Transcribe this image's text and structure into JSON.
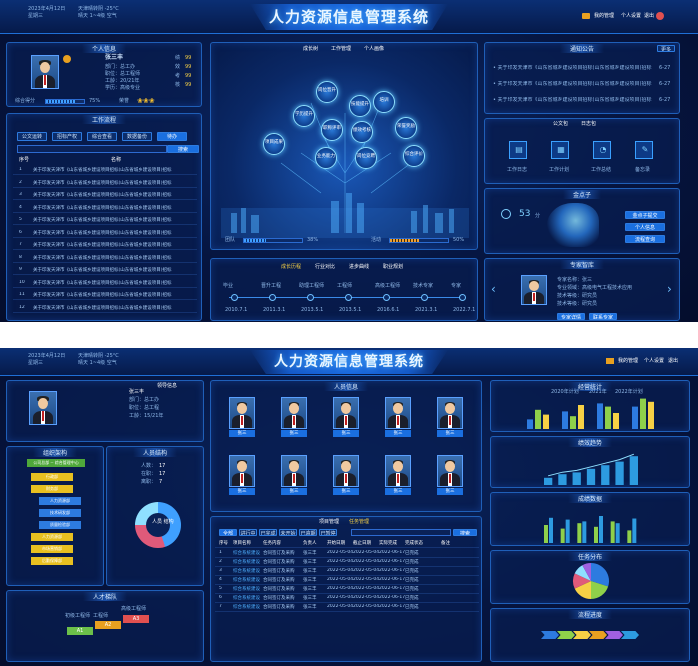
{
  "header": {
    "title": "人力资源信息管理系统",
    "date": "2023年4月12日",
    "weekday": "星期三",
    "weather": "天津晴转阴 -25°C",
    "air": "晴天 1~4级 空气",
    "nav": "我的管理",
    "personal": "个人设置",
    "exit": "退出"
  },
  "profile": {
    "title": "个人信息",
    "name": "张三丰",
    "dept": "部门：总工办",
    "post": "职位：总工程师",
    "work": "工龄：20/21年",
    "edu": "学历：高级专业",
    "labels": [
      "绩",
      "效",
      "考",
      "核"
    ],
    "scores": [
      "99",
      "99",
      "99",
      "99"
    ],
    "progress_label": "综合得分",
    "progress_pct": "75%",
    "progress_value": 0.75,
    "badge_label": "荣誉"
  },
  "work_flow": {
    "title": "工作流程",
    "tabs": [
      "公文运转",
      "招标产权",
      "综合查看",
      "数据备份",
      "待办"
    ],
    "search_btn": "搜索",
    "col_no": "序号",
    "col_name": "名称",
    "rows": [
      "1",
      "2",
      "3",
      "4",
      "5",
      "6",
      "7",
      "8",
      "9",
      "10",
      "11",
      "12"
    ],
    "row_text": "关于印发天津市《山东省城乡建设项目招标(山东省城乡建设项目)招标"
  },
  "growth": {
    "tabs": [
      "成长树",
      "工作管理",
      "个人画像"
    ],
    "nodes": [
      "岗位晋升",
      "技能提升",
      "培训",
      "学历提升",
      "荣誉奖励",
      "职称评审",
      "绩效考核",
      "项目成果",
      "业务能力",
      "岗位竞聘",
      "综合评价"
    ],
    "stat1_label": "团队",
    "stat1_val": "已完成",
    "stat1_pct": "38%",
    "stat2_label": "活动",
    "stat2_val": "已完成",
    "stat2_pct": "50%",
    "stat1_value": 0.38,
    "stat2_value": 0.5
  },
  "career": {
    "tabs": [
      "成长历程",
      "行业对比",
      "进步曲线",
      "职业规划"
    ],
    "steps": [
      "毕业",
      "晋升工程",
      "助理工程师",
      "工程师",
      "高级工程师",
      "技术专家",
      "专家"
    ],
    "dates": [
      "2010.7.1",
      "2011.3.1",
      "2013.5.1",
      "2013.5.1",
      "2016.6.1",
      "2021.3.1",
      "2022.7.1"
    ]
  },
  "notice": {
    "title": "通知公告",
    "more": "更多",
    "items": [
      {
        "text": "• 关于印发天津市《山东省城乡建设项目招标(山东省城乡建设项目)招标",
        "date": "6-27"
      },
      {
        "text": "• 关于印发天津市《山东省城乡建设项目招标(山东省城乡建设项目)招标",
        "date": "6-27"
      },
      {
        "text": "• 关于印发天津市《山东省城乡建设项目招标(山东省城乡建设项目)招标",
        "date": "6-27"
      }
    ]
  },
  "docs": {
    "title": "公文包",
    "title2": "日志包",
    "items": [
      "工作日志",
      "工作计划",
      "工作总结",
      "备忘录"
    ]
  },
  "iq": {
    "title": "金点子",
    "score": "53",
    "unit": "分",
    "tags": [
      "金点子提交",
      "个人信息",
      "流程查询"
    ]
  },
  "expert": {
    "title": "专家智库",
    "name": "专家名称：张三",
    "field": "专业领域：高级电气工程技术应用",
    "level": "技术等级：研究员",
    "level2": "技术等级：研究员",
    "btn1": "专家详情",
    "btn2": "联系专家"
  },
  "leader": {
    "title": "领导信息",
    "name": "张三丰",
    "dept": "部门：总工办",
    "job": "职位：总工程",
    "age": "工龄：15/21年"
  },
  "org": {
    "title": "组织架构",
    "root": "公司总部 -- 综合管理中心",
    "items": [
      "行政部",
      "财务部",
      "人力资源部",
      "技术研发部",
      "质量检验部",
      "人力资源部",
      "市场营销部",
      "后勤保障部"
    ]
  },
  "people": {
    "title": "人员结构",
    "stats": [
      {
        "label": "人数：",
        "val": "17"
      },
      {
        "label": "在职：",
        "val": "17"
      },
      {
        "label": "离职：",
        "val": "7"
      }
    ],
    "donut_label": "人员\n结构"
  },
  "talent": {
    "title": "人才梯队",
    "levels": [
      "初级工程师",
      "工程师",
      "高级工程师"
    ],
    "codes": [
      "A1",
      "A2",
      "A3"
    ]
  },
  "team": {
    "title": "人员信息",
    "names": [
      "张三",
      "张三",
      "张三",
      "张三",
      "张三",
      "张三",
      "张三",
      "张三",
      "张三",
      "张三"
    ]
  },
  "projects": {
    "tab1": "项目管理",
    "tab2": "任务管理",
    "filters": [
      "全部",
      "进行中",
      "已完成",
      "未开始",
      "已逾期",
      "已暂停"
    ],
    "search": "搜索",
    "cols": [
      "序号",
      "项目名称",
      "任务内容",
      "负责人",
      "开始日期",
      "截止日期",
      "实际完成",
      "完成状态",
      "备注"
    ],
    "rows": [
      [
        "1",
        "综合系统建设",
        "合同签订及采购",
        "张三丰",
        "2022-05-04",
        "2022-05-04",
        "2022-06-17",
        "已完成",
        ""
      ],
      [
        "2",
        "综合系统建设",
        "合同签订及采购",
        "张三丰",
        "2022-05-04",
        "2022-05-04",
        "2022-06-17",
        "已完成",
        ""
      ],
      [
        "3",
        "综合系统建设",
        "合同签订及采购",
        "张三丰",
        "2022-05-04",
        "2022-05-04",
        "2022-06-17",
        "已完成",
        ""
      ],
      [
        "4",
        "综合系统建设",
        "合同签订及采购",
        "张三丰",
        "2022-05-04",
        "2022-05-04",
        "2022-06-17",
        "已完成",
        ""
      ],
      [
        "5",
        "综合系统建设",
        "合同签订及采购",
        "张三丰",
        "2022-05-04",
        "2022-05-04",
        "2022-06-17",
        "已完成",
        ""
      ],
      [
        "6",
        "综合系统建设",
        "合同签订及采购",
        "张三丰",
        "2022-05-04",
        "2022-05-04",
        "2022-06-17",
        "已完成",
        ""
      ],
      [
        "7",
        "综合系统建设",
        "合同签订及采购",
        "张三丰",
        "2022-05-04",
        "2022-05-04",
        "2022-06-17",
        "已完成",
        ""
      ]
    ]
  },
  "right2": {
    "t1": "经营统计",
    "t2": "绩效趋势",
    "t3": "成绩数据",
    "t4": "任务分布",
    "t5": "流程进度",
    "legend": [
      "2020年计划",
      "2021年",
      "2022年计划"
    ]
  },
  "chart_data": [
    {
      "type": "bar",
      "categories": [
        "1",
        "2",
        "3",
        "4"
      ],
      "series": [
        {
          "values": [
            30,
            55,
            80,
            70
          ]
        },
        {
          "values": [
            60,
            40,
            70,
            95
          ]
        },
        {
          "values": [
            45,
            75,
            50,
            85
          ]
        }
      ],
      "ylim": [
        0,
        100
      ]
    },
    {
      "type": "bar",
      "categories": [
        "1",
        "2",
        "3",
        "4",
        "5",
        "6",
        "7"
      ],
      "values": [
        20,
        30,
        35,
        45,
        55,
        65,
        80
      ],
      "ylim": [
        0,
        100
      ]
    },
    {
      "type": "bar",
      "categories": [
        "1",
        "2",
        "3",
        "4",
        "5",
        "6"
      ],
      "series": [
        {
          "values": [
            50,
            40,
            55,
            45,
            60,
            35
          ]
        },
        {
          "values": [
            70,
            65,
            60,
            75,
            55,
            68
          ]
        }
      ],
      "ylim": [
        0,
        100
      ]
    },
    {
      "type": "pie",
      "values": [
        30,
        20,
        18,
        14,
        10,
        8
      ]
    }
  ],
  "colors": {
    "accent": "#2d7be0",
    "bg": "#061540",
    "green": "#6cc04a",
    "red": "#e05050",
    "orange": "#e8a020"
  }
}
